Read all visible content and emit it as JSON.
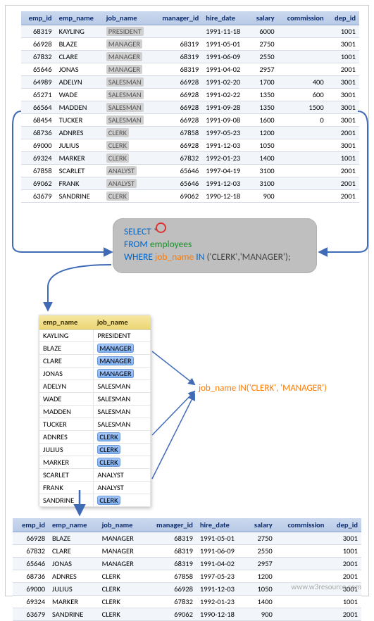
{
  "columns": [
    "emp_id",
    "emp_name",
    "job_name",
    "manager_id",
    "hire_date",
    "salary",
    "commission",
    "dep_id"
  ],
  "top_rows": [
    {
      "emp_id": "68319",
      "emp_name": "KAYLING",
      "job_name": "PRESIDENT",
      "manager_id": "",
      "hire_date": "1991-11-18",
      "salary": "6000",
      "commission": "",
      "dep_id": "1001"
    },
    {
      "emp_id": "66928",
      "emp_name": "BLAZE",
      "job_name": "MANAGER",
      "manager_id": "68319",
      "hire_date": "1991-05-01",
      "salary": "2750",
      "commission": "",
      "dep_id": "3001"
    },
    {
      "emp_id": "67832",
      "emp_name": "CLARE",
      "job_name": "MANAGER",
      "manager_id": "68319",
      "hire_date": "1991-06-09",
      "salary": "2550",
      "commission": "",
      "dep_id": "1001"
    },
    {
      "emp_id": "65646",
      "emp_name": "JONAS",
      "job_name": "MANAGER",
      "manager_id": "68319",
      "hire_date": "1991-04-02",
      "salary": "2957",
      "commission": "",
      "dep_id": "2001"
    },
    {
      "emp_id": "64989",
      "emp_name": "ADELYN",
      "job_name": "SALESMAN",
      "manager_id": "66928",
      "hire_date": "1991-02-20",
      "salary": "1700",
      "commission": "400",
      "dep_id": "3001"
    },
    {
      "emp_id": "65271",
      "emp_name": "WADE",
      "job_name": "SALESMAN",
      "manager_id": "66928",
      "hire_date": "1991-02-22",
      "salary": "1350",
      "commission": "600",
      "dep_id": "3001"
    },
    {
      "emp_id": "66564",
      "emp_name": "MADDEN",
      "job_name": "SALESMAN",
      "manager_id": "66928",
      "hire_date": "1991-09-28",
      "salary": "1350",
      "commission": "1500",
      "dep_id": "3001"
    },
    {
      "emp_id": "68454",
      "emp_name": "TUCKER",
      "job_name": "SALESMAN",
      "manager_id": "66928",
      "hire_date": "1991-09-08",
      "salary": "1600",
      "commission": "0",
      "dep_id": "3001"
    },
    {
      "emp_id": "68736",
      "emp_name": "ADNRES",
      "job_name": "CLERK",
      "manager_id": "67858",
      "hire_date": "1997-05-23",
      "salary": "1200",
      "commission": "",
      "dep_id": "2001"
    },
    {
      "emp_id": "69000",
      "emp_name": "JULIUS",
      "job_name": "CLERK",
      "manager_id": "66928",
      "hire_date": "1991-12-03",
      "salary": "1050",
      "commission": "",
      "dep_id": "3001"
    },
    {
      "emp_id": "69324",
      "emp_name": "MARKER",
      "job_name": "CLERK",
      "manager_id": "67832",
      "hire_date": "1992-01-23",
      "salary": "1400",
      "commission": "",
      "dep_id": "1001"
    },
    {
      "emp_id": "67858",
      "emp_name": "SCARLET",
      "job_name": "ANALYST",
      "manager_id": "65646",
      "hire_date": "1997-04-19",
      "salary": "3100",
      "commission": "",
      "dep_id": "2001"
    },
    {
      "emp_id": "69062",
      "emp_name": "FRANK",
      "job_name": "ANALYST",
      "manager_id": "65646",
      "hire_date": "1991-12-03",
      "salary": "3100",
      "commission": "",
      "dep_id": "2001"
    },
    {
      "emp_id": "63679",
      "emp_name": "SANDRINE",
      "job_name": "CLERK",
      "manager_id": "69062",
      "hire_date": "1990-12-18",
      "salary": "900",
      "commission": "",
      "dep_id": "2001"
    }
  ],
  "sql": {
    "select": "SELECT",
    "star": " *",
    "from": "FROM ",
    "table": "employees",
    "where": "WHERE ",
    "col": "job_name",
    "inkw": " IN ",
    "list": "('CLERK','MANAGER');"
  },
  "mid_cols": [
    "emp_name",
    "job_name"
  ],
  "mid_rows": [
    {
      "emp_name": "KAYLING",
      "job_name": "PRESIDENT",
      "hl": false
    },
    {
      "emp_name": "BLAZE",
      "job_name": "MANAGER",
      "hl": true
    },
    {
      "emp_name": "CLARE",
      "job_name": "MANAGER",
      "hl": true
    },
    {
      "emp_name": "JONAS",
      "job_name": "MANAGER",
      "hl": true
    },
    {
      "emp_name": "ADELYN",
      "job_name": "SALESMAN",
      "hl": false
    },
    {
      "emp_name": "WADE",
      "job_name": "SALESMAN",
      "hl": false
    },
    {
      "emp_name": "MADDEN",
      "job_name": "SALESMAN",
      "hl": false
    },
    {
      "emp_name": "TUCKER",
      "job_name": "SALESMAN",
      "hl": false
    },
    {
      "emp_name": "ADNRES",
      "job_name": "CLERK",
      "hl": true
    },
    {
      "emp_name": "JULIUS",
      "job_name": "CLERK",
      "hl": true
    },
    {
      "emp_name": "MARKER",
      "job_name": "CLERK",
      "hl": true
    },
    {
      "emp_name": "SCARLET",
      "job_name": "ANALYST",
      "hl": false
    },
    {
      "emp_name": "FRANK",
      "job_name": "ANALYST",
      "hl": false
    },
    {
      "emp_name": "SANDRINE",
      "job_name": "CLERK",
      "hl": true
    }
  ],
  "annotation": "job_name IN('CLERK', 'MANAGER')",
  "bot_rows": [
    {
      "emp_id": "66928",
      "emp_name": "BLAZE",
      "job_name": "MANAGER",
      "manager_id": "68319",
      "hire_date": "1991-05-01",
      "salary": "2750",
      "commission": "",
      "dep_id": "3001"
    },
    {
      "emp_id": "67832",
      "emp_name": "CLARE",
      "job_name": "MANAGER",
      "manager_id": "68319",
      "hire_date": "1991-06-09",
      "salary": "2550",
      "commission": "",
      "dep_id": "1001"
    },
    {
      "emp_id": "65646",
      "emp_name": "JONAS",
      "job_name": "MANAGER",
      "manager_id": "68319",
      "hire_date": "1991-04-02",
      "salary": "2957",
      "commission": "",
      "dep_id": "2001"
    },
    {
      "emp_id": "68736",
      "emp_name": "ADNRES",
      "job_name": "CLERK",
      "manager_id": "67858",
      "hire_date": "1997-05-23",
      "salary": "1200",
      "commission": "",
      "dep_id": "2001"
    },
    {
      "emp_id": "69000",
      "emp_name": "JULIUS",
      "job_name": "CLERK",
      "manager_id": "66928",
      "hire_date": "1991-12-03",
      "salary": "1050",
      "commission": "",
      "dep_id": "3001"
    },
    {
      "emp_id": "69324",
      "emp_name": "MARKER",
      "job_name": "CLERK",
      "manager_id": "67832",
      "hire_date": "1992-01-23",
      "salary": "1400",
      "commission": "",
      "dep_id": "1001"
    },
    {
      "emp_id": "63679",
      "emp_name": "SANDRINE",
      "job_name": "CLERK",
      "manager_id": "69062",
      "hire_date": "1990-12-18",
      "salary": "900",
      "commission": "",
      "dep_id": "2001"
    }
  ],
  "watermark": "www.w3resource.com"
}
